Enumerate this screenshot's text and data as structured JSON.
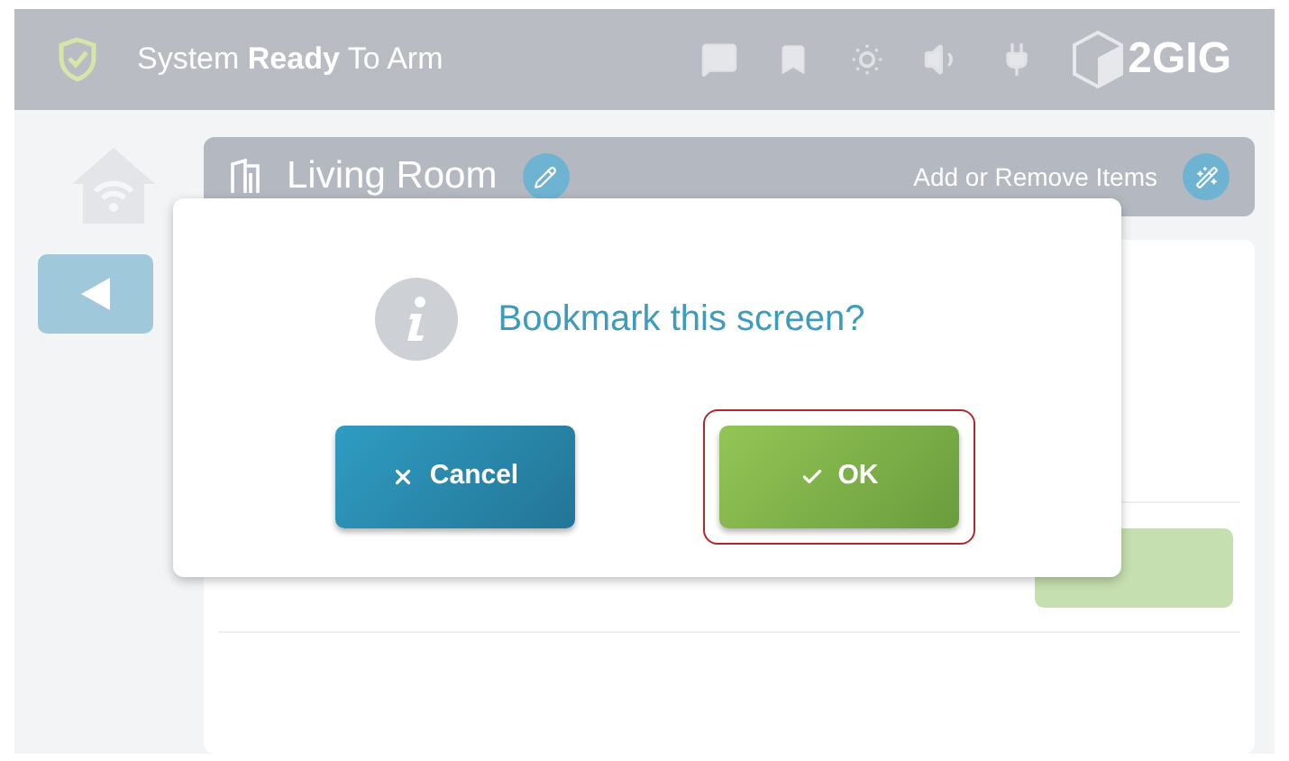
{
  "status_bar": {
    "status": "System **Ready** To Arm",
    "logo": "2GIG"
  },
  "room_header": {
    "title": "Living Room",
    "action": "Add or Remove Items"
  },
  "dialog": {
    "message": "Bookmark this screen?",
    "buttons": [
      {
        "kind": "cancel",
        "label": "Cancel",
        "selected": false
      },
      {
        "kind": "ok",
        "label": "OK",
        "selected": true
      }
    ]
  }
}
